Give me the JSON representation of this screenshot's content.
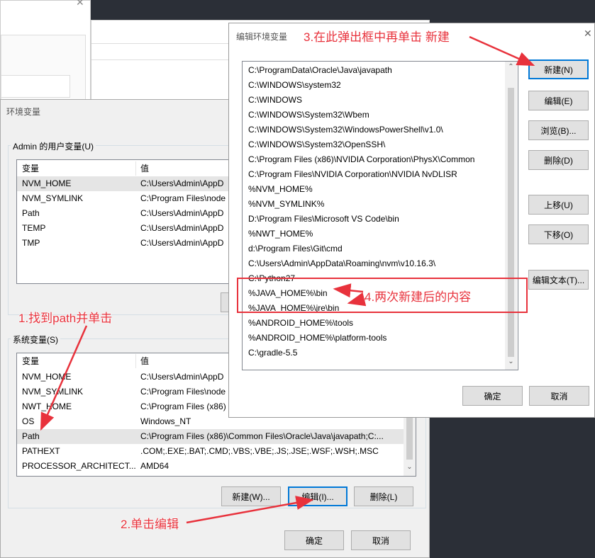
{
  "env_window": {
    "title": "环境变量",
    "user_group_label": "Admin 的用户变量(U)",
    "user_headers": [
      "变量",
      "值"
    ],
    "user_rows": [
      {
        "name": "NVM_HOME",
        "value": "C:\\Users\\Admin\\AppD"
      },
      {
        "name": "NVM_SYMLINK",
        "value": "C:\\Program Files\\node"
      },
      {
        "name": "Path",
        "value": "C:\\Users\\Admin\\AppD"
      },
      {
        "name": "TEMP",
        "value": "C:\\Users\\Admin\\AppD"
      },
      {
        "name": "TMP",
        "value": "C:\\Users\\Admin\\AppD"
      }
    ],
    "system_group_label": "系统变量(S)",
    "system_headers": [
      "变量",
      "值"
    ],
    "system_rows": [
      {
        "name": "NVM_HOME",
        "value": "C:\\Users\\Admin\\AppD"
      },
      {
        "name": "NVM_SYMLINK",
        "value": "C:\\Program Files\\node"
      },
      {
        "name": "NWT_HOME",
        "value": "C:\\Program Files (x86)"
      },
      {
        "name": "OS",
        "value": "Windows_NT"
      },
      {
        "name": "Path",
        "value": "C:\\Program Files (x86)\\Common Files\\Oracle\\Java\\javapath;C:..."
      },
      {
        "name": "PATHEXT",
        "value": ".COM;.EXE;.BAT;.CMD;.VBS;.VBE;.JS;.JSE;.WSF;.WSH;.MSC"
      },
      {
        "name": "PROCESSOR_ARCHITECT...",
        "value": "AMD64"
      }
    ],
    "buttons": {
      "new": "新建(W)...",
      "edit": "编辑(I)...",
      "delete": "删除(L)",
      "ok": "确定",
      "cancel": "取消"
    }
  },
  "edit_dialog": {
    "title": "编辑环境变量",
    "close_glyph": "✕",
    "paths": [
      "C:\\ProgramData\\Oracle\\Java\\javapath",
      "C:\\WINDOWS\\system32",
      "C:\\WINDOWS",
      "C:\\WINDOWS\\System32\\Wbem",
      "C:\\WINDOWS\\System32\\WindowsPowerShell\\v1.0\\",
      "C:\\WINDOWS\\System32\\OpenSSH\\",
      "C:\\Program Files (x86)\\NVIDIA Corporation\\PhysX\\Common",
      "C:\\Program Files\\NVIDIA Corporation\\NVIDIA NvDLISR",
      "%NVM_HOME%",
      "%NVM_SYMLINK%",
      "D:\\Program Files\\Microsoft VS Code\\bin",
      "%NWT_HOME%",
      "d:\\Program Files\\Git\\cmd",
      "C:\\Users\\Admin\\AppData\\Roaming\\nvm\\v10.16.3\\",
      "C:\\Python27",
      "%JAVA_HOME%\\bin",
      "%JAVA_HOME%\\jre\\bin",
      "%ANDROID_HOME%\\tools",
      "%ANDROID_HOME%\\platform-tools",
      "C:\\gradle-5.5"
    ],
    "buttons": {
      "new": "新建(N)",
      "edit": "编辑(E)",
      "browse": "浏览(B)...",
      "delete": "删除(D)",
      "move_up": "上移(U)",
      "move_down": "下移(O)",
      "edit_text": "编辑文本(T)...",
      "ok": "确定",
      "cancel": "取消"
    }
  },
  "annotations": {
    "step1": "1.找到path并单击",
    "step2": "2.单击编辑",
    "step3": "3.在此弹出框中再单击 新建",
    "step4": "4.两次新建后的内容"
  },
  "colors": {
    "annotation": "#e8323c",
    "selection": "#e5e5e5",
    "focus_border": "#0078d7"
  },
  "icons": {
    "close": "close-icon",
    "scroll_up": "chevron-up-icon",
    "scroll_down": "chevron-down-icon"
  }
}
